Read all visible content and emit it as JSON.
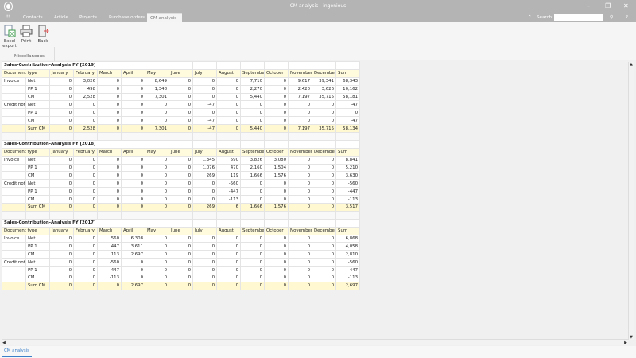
{
  "window": {
    "title": "CM analysis - ingenious",
    "minimize": "–",
    "maximize": "❐",
    "close": "✕"
  },
  "tabs": [
    {
      "label": "Contacts"
    },
    {
      "label": "Article"
    },
    {
      "label": "Projects"
    },
    {
      "label": "Purchase orders"
    },
    {
      "label": "CM analysis",
      "active": true
    }
  ],
  "search": {
    "label": "Search:",
    "value": "",
    "collapse": "⌃",
    "help": "?"
  },
  "ribbon": {
    "buttons": [
      {
        "label": "Excel export",
        "icon": "excel-export-icon"
      },
      {
        "label": "Print",
        "icon": "printer-icon"
      },
      {
        "label": "Back",
        "icon": "back-door-icon"
      }
    ],
    "group": "Miscellaneous"
  },
  "columns": [
    "Document type",
    "",
    "January",
    "February",
    "March",
    "April",
    "May",
    "June",
    "July",
    "August",
    "September",
    "October",
    "November",
    "December",
    "Sum"
  ],
  "reports": [
    {
      "title": "Sales-Contribution-Analysis FY [2019]",
      "rows": [
        [
          "Invoice",
          "Net",
          "0",
          "3,026",
          "0",
          "0",
          "8,649",
          "0",
          "0",
          "0",
          "7,710",
          "0",
          "9,617",
          "39,341",
          "68,343"
        ],
        [
          "",
          "PP 1",
          "0",
          "498",
          "0",
          "0",
          "1,348",
          "0",
          "0",
          "0",
          "2,270",
          "0",
          "2,420",
          "3,626",
          "10,162"
        ],
        [
          "",
          "CM",
          "0",
          "2,528",
          "0",
          "0",
          "7,301",
          "0",
          "0",
          "0",
          "5,440",
          "0",
          "7,197",
          "35,715",
          "58,181"
        ],
        [
          "Credit note",
          "Net",
          "0",
          "0",
          "0",
          "0",
          "0",
          "0",
          "-47",
          "0",
          "0",
          "0",
          "0",
          "0",
          "-47"
        ],
        [
          "",
          "PP 1",
          "0",
          "0",
          "0",
          "0",
          "0",
          "0",
          "0",
          "0",
          "0",
          "0",
          "0",
          "0",
          "0"
        ],
        [
          "",
          "CM",
          "0",
          "0",
          "0",
          "0",
          "0",
          "0",
          "-47",
          "0",
          "0",
          "0",
          "0",
          "0",
          "-47"
        ],
        [
          "",
          "Sum CM",
          "0",
          "2,528",
          "0",
          "0",
          "7,301",
          "0",
          "-47",
          "0",
          "5,440",
          "0",
          "7,197",
          "35,715",
          "58,134"
        ]
      ]
    },
    {
      "title": "Sales-Contribution-Analysis FY [2018]",
      "rows": [
        [
          "Invoice",
          "Net",
          "0",
          "0",
          "0",
          "0",
          "0",
          "0",
          "1,345",
          "590",
          "3,826",
          "3,080",
          "0",
          "0",
          "8,841"
        ],
        [
          "",
          "PP 1",
          "0",
          "0",
          "0",
          "0",
          "0",
          "0",
          "1,076",
          "470",
          "2,160",
          "1,504",
          "0",
          "0",
          "5,210"
        ],
        [
          "",
          "CM",
          "0",
          "0",
          "0",
          "0",
          "0",
          "0",
          "269",
          "119",
          "1,666",
          "1,576",
          "0",
          "0",
          "3,630"
        ],
        [
          "Credit note",
          "Net",
          "0",
          "0",
          "0",
          "0",
          "0",
          "0",
          "0",
          "-560",
          "0",
          "0",
          "0",
          "0",
          "-560"
        ],
        [
          "",
          "PP 1",
          "0",
          "0",
          "0",
          "0",
          "0",
          "0",
          "0",
          "-447",
          "0",
          "0",
          "0",
          "0",
          "-447"
        ],
        [
          "",
          "CM",
          "0",
          "0",
          "0",
          "0",
          "0",
          "0",
          "0",
          "-113",
          "0",
          "0",
          "0",
          "0",
          "-113"
        ],
        [
          "",
          "Sum CM",
          "0",
          "0",
          "0",
          "0",
          "0",
          "0",
          "269",
          "6",
          "1,666",
          "1,576",
          "0",
          "0",
          "3,517"
        ]
      ]
    },
    {
      "title": "Sales-Contribution-Analysis FY [2017]",
      "rows": [
        [
          "Invoice",
          "Net",
          "0",
          "0",
          "560",
          "6,308",
          "0",
          "0",
          "0",
          "0",
          "0",
          "0",
          "0",
          "0",
          "6,868"
        ],
        [
          "",
          "PP 1",
          "0",
          "0",
          "447",
          "3,611",
          "0",
          "0",
          "0",
          "0",
          "0",
          "0",
          "0",
          "0",
          "4,058"
        ],
        [
          "",
          "CM",
          "0",
          "0",
          "113",
          "2,697",
          "0",
          "0",
          "0",
          "0",
          "0",
          "0",
          "0",
          "0",
          "2,810"
        ],
        [
          "Credit note",
          "Net",
          "0",
          "0",
          "-560",
          "0",
          "0",
          "0",
          "0",
          "0",
          "0",
          "0",
          "0",
          "0",
          "-560"
        ],
        [
          "",
          "PP 1",
          "0",
          "0",
          "-447",
          "0",
          "0",
          "0",
          "0",
          "0",
          "0",
          "0",
          "0",
          "0",
          "-447"
        ],
        [
          "",
          "CM",
          "0",
          "0",
          "-113",
          "0",
          "0",
          "0",
          "0",
          "0",
          "0",
          "0",
          "0",
          "0",
          "-113"
        ],
        [
          "",
          "Sum CM",
          "0",
          "0",
          "0",
          "2,697",
          "0",
          "0",
          "0",
          "0",
          "0",
          "0",
          "0",
          "0",
          "2,697"
        ]
      ]
    }
  ],
  "bottom_tab": "CM analysis",
  "colors": {
    "titlebar": "#b4b4b4",
    "header_row": "#fffbdc",
    "sum_row": "#fff8d0",
    "accent": "#3a7fc8"
  }
}
